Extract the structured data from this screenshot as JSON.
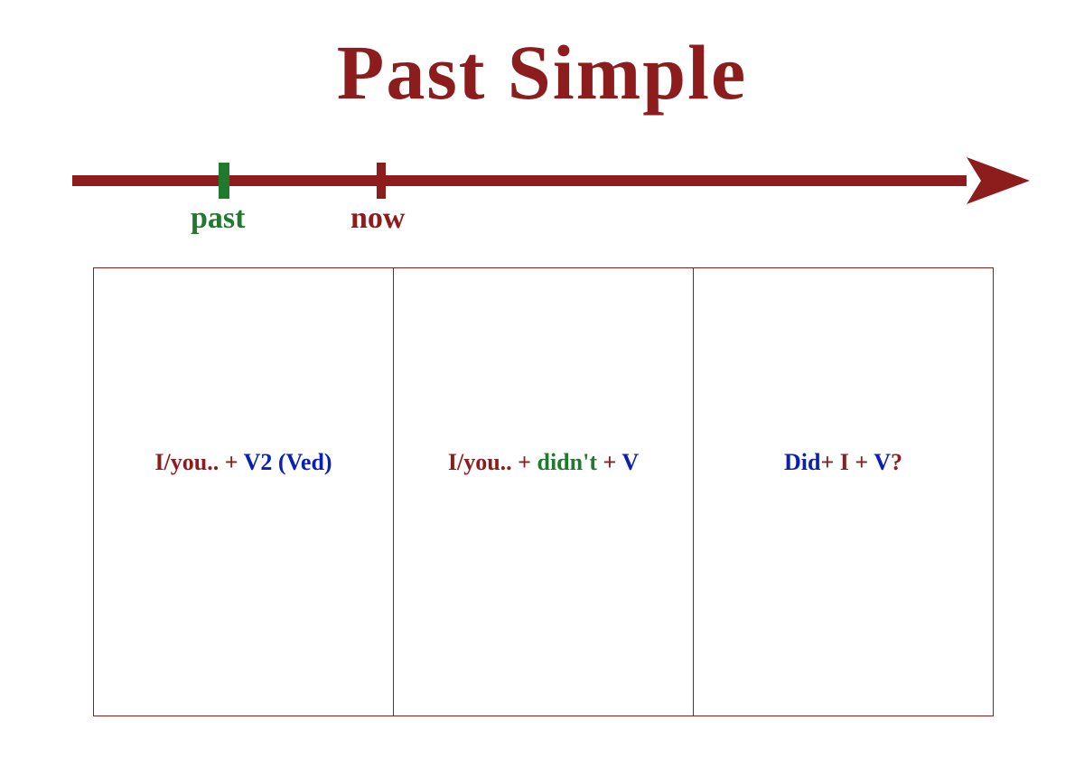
{
  "title": "Past Simple",
  "timeline": {
    "past_label": "past",
    "now_label": "now"
  },
  "colors": {
    "maroon": "#8d1d1d",
    "blue": "#0a1fb5",
    "green": "#1f7a2e"
  },
  "cells": {
    "affirmative": {
      "subj": "I/you.. ",
      "plus1": "+ ",
      "verb": "V2 (Ved)"
    },
    "negative": {
      "subj": "I/you.. ",
      "plus1": "+ ",
      "aux": "didn't ",
      "plus2": "+  ",
      "verb": "V"
    },
    "question": {
      "aux": "Did",
      "plus1": "+ ",
      "subj": "I ",
      "plus2": "+ ",
      "verb": "V",
      "qmark": "?"
    }
  }
}
